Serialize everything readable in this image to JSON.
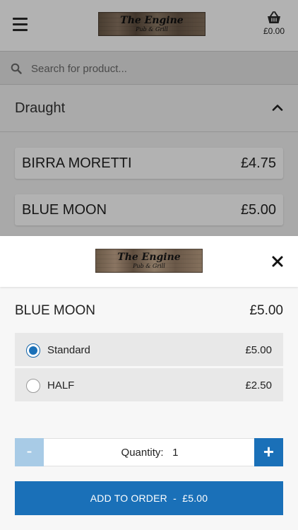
{
  "header": {
    "logo_title": "The Engine",
    "logo_subtitle": "Pub & Grill",
    "basket_total": "£0.00"
  },
  "search": {
    "placeholder": "Search for product..."
  },
  "category": {
    "label": "Draught"
  },
  "products": [
    {
      "name": "BIRRA MORETTI",
      "price": "£4.75"
    },
    {
      "name": "BLUE MOON",
      "price": "£5.00"
    }
  ],
  "modal": {
    "logo_title": "The Engine",
    "logo_subtitle": "Pub & Grill",
    "item_name": "BLUE MOON",
    "item_price": "£5.00",
    "options": [
      {
        "label": "Standard",
        "price": "£5.00",
        "selected": true
      },
      {
        "label": "HALF",
        "price": "£2.50",
        "selected": false
      }
    ],
    "quantity_label": "Quantity:",
    "quantity_value": "1",
    "minus_label": "-",
    "plus_label": "+",
    "add_label": "ADD TO ORDER",
    "add_separator": "-",
    "add_price": "£5.00"
  },
  "colors": {
    "accent": "#1a70b8",
    "accent_disabled": "#a8cbe6"
  },
  "icons": {
    "menu": "hamburger-icon",
    "basket": "basket-icon",
    "search": "search-icon",
    "collapse": "chevron-up-icon",
    "close": "close-icon"
  }
}
